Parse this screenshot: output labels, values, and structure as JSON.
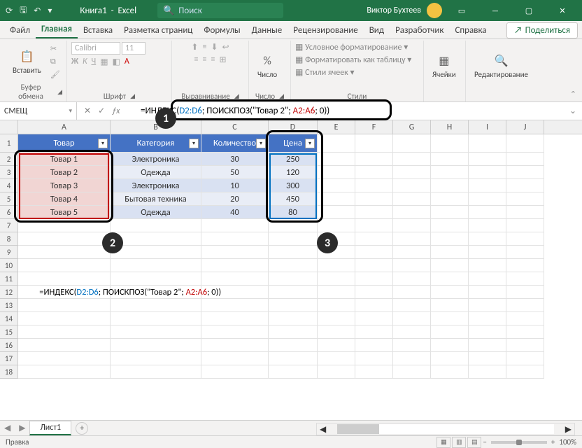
{
  "titlebar": {
    "autosave": "⟳",
    "save": "🖫",
    "undo": "↶",
    "title_doc": "Книга1",
    "title_app": "Excel",
    "search_placeholder": "Поиск",
    "user_name": "Виктор Бухтеев",
    "win_min": "—",
    "win_max": "▢",
    "win_close": "✕"
  },
  "tabs": {
    "file": "Файл",
    "home": "Главная",
    "insert": "Вставка",
    "layout": "Разметка страниц",
    "formulas": "Формулы",
    "data": "Данные",
    "review": "Рецензирование",
    "view": "Вид",
    "developer": "Разработчик",
    "help": "Справка",
    "share": "Поделиться"
  },
  "ribbon": {
    "clipboard": {
      "paste": "Вставить",
      "label": "Буфер обмена"
    },
    "font": {
      "name_ph": "Calibri",
      "size_ph": "11",
      "bold": "Ж",
      "italic": "К",
      "underline": "Ч",
      "label": "Шрифт"
    },
    "align": {
      "label": "Выравнивание"
    },
    "number": {
      "btn": "Число",
      "pct": "%",
      "label": "Число"
    },
    "styles": {
      "cond": "Условное форматирование",
      "table": "Форматировать как таблицу",
      "cells": "Стили ячеек",
      "label": "Стили"
    },
    "cells_grp": {
      "label": "Ячейки"
    },
    "editing": {
      "label": "Редактирование"
    }
  },
  "fbar": {
    "namebox": "СМЕЩ",
    "cancel": "✕",
    "confirm": "✓",
    "fx": "ƒx",
    "f_eq": "=",
    "f_func1": "ИНДЕКС(",
    "f_rng1": "D2:D6",
    "f_sep1": "; ",
    "f_func2": "ПОИСКПОЗ(",
    "f_str": "\"Товар 2\"",
    "f_sep2": "; ",
    "f_rng2": "A2:A6",
    "f_sep3": "; ",
    "f_zero": "0",
    "f_close": "))"
  },
  "headers": {
    "product": "Товар",
    "category": "Категория",
    "qty": "Количество",
    "price": "Цена"
  },
  "table": {
    "rows": [
      {
        "a": "Товар 1",
        "b": "Электроника",
        "c": "30",
        "d": "250"
      },
      {
        "a": "Товар 2",
        "b": "Одежда",
        "c": "50",
        "d": "120"
      },
      {
        "a": "Товар 3",
        "b": "Электроника",
        "c": "10",
        "d": "300"
      },
      {
        "a": "Товар 4",
        "b": "Бытовая техника",
        "c": "20",
        "d": "450"
      },
      {
        "a": "Товар 5",
        "b": "Одежда",
        "c": "40",
        "d": "80"
      }
    ]
  },
  "cols": [
    "A",
    "B",
    "C",
    "D",
    "E",
    "F",
    "G",
    "H",
    "I",
    "J"
  ],
  "rownums": [
    "1",
    "2",
    "3",
    "4",
    "5",
    "6",
    "7",
    "8",
    "9",
    "10",
    "11",
    "12",
    "13",
    "14",
    "15",
    "16",
    "17",
    "18"
  ],
  "cell_a12": "=ИНДЕКС(D2:D6; ПОИСКПОЗ(\"Товар 2\"; A2:A6; 0))",
  "callouts": {
    "n1": "1",
    "n2": "2",
    "n3": "3"
  },
  "sheet": {
    "name": "Лист1",
    "add": "+"
  },
  "status": {
    "mode": "Правка",
    "zoom": "100%"
  }
}
